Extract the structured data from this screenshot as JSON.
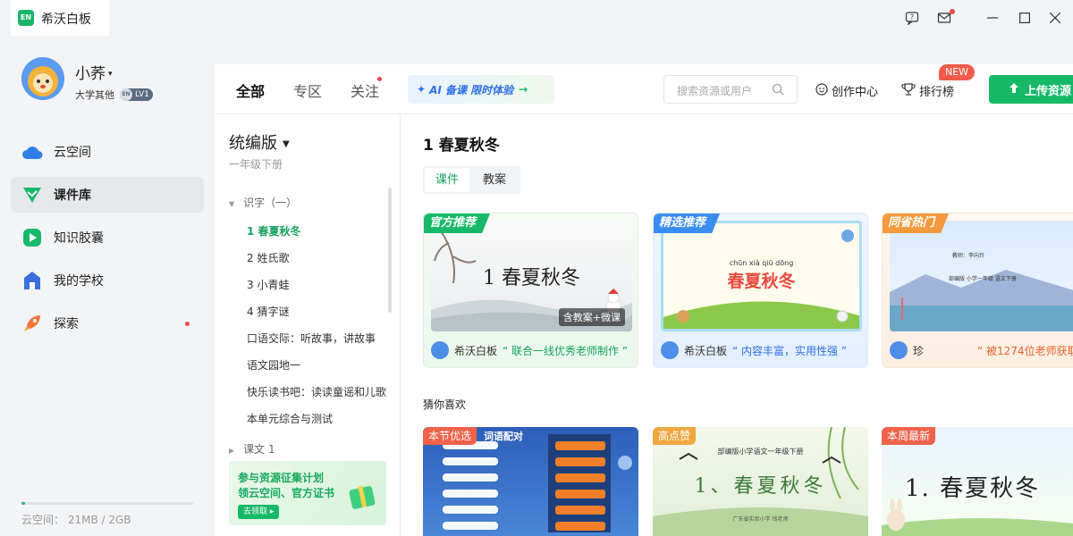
{
  "app": {
    "title": "希沃白板",
    "logo_text": "EN"
  },
  "user": {
    "name": "小荞",
    "role": "大学其他",
    "level": "LV1",
    "level_prefix": "EN"
  },
  "sidebar": {
    "items": [
      {
        "label": "云空间",
        "active": false
      },
      {
        "label": "课件库",
        "active": true
      },
      {
        "label": "知识胶囊",
        "active": false
      },
      {
        "label": "我的学校",
        "active": false
      },
      {
        "label": "探索",
        "active": false
      }
    ],
    "storage": {
      "text": "云空间：  21MB / 2GB",
      "used_fraction": 0.01
    }
  },
  "topnav": {
    "tabs": [
      {
        "label": "全部",
        "active": true
      },
      {
        "label": "专区",
        "active": false
      },
      {
        "label": "关注",
        "active": false
      }
    ],
    "ai_banner": "AI 备课 限时体验",
    "search_placeholder": "搜索资源或用户",
    "create_center": "创作中心",
    "ranking": "排行榜",
    "new_badge": "NEW",
    "upload": "上传资源"
  },
  "tree": {
    "edition": "统编版",
    "grade": "一年级下册",
    "unit1": "识字（一）",
    "lessons": [
      "1 春夏秋冬",
      "2 姓氏歌",
      "3 小青蛙",
      "4 猜字谜",
      "口语交际：听故事，讲故事",
      "语文园地一",
      "快乐读书吧：读读童谣和儿歌",
      "本单元综合与测试"
    ],
    "unit2": "课文 1",
    "promo": {
      "line1": "参与资源征集计划",
      "line2": "领云空间、官方证书",
      "button": "去领取 ▸"
    }
  },
  "content": {
    "title": "1 春夏秋冬",
    "segments": [
      {
        "label": "课件",
        "active": true
      },
      {
        "label": "教案",
        "active": false
      }
    ],
    "cards": [
      {
        "tag": "官方推荐",
        "image_title": "1 春夏秋冬",
        "image_badge": "含教案+微课",
        "author": "希沃白板",
        "quote": "联合一线优秀老师制作"
      },
      {
        "tag": "精选推荐",
        "pinyin": "chūn xià qiū dōng",
        "image_title": "春夏秋冬",
        "author": "希沃白板",
        "quote": "内容丰富，实用性强"
      },
      {
        "tag": "同省热门",
        "image_line1": "教师：李向玲",
        "image_line2": "部编版 小学一年级 语文下册",
        "author": "珍",
        "quote": "被1274位老师获取"
      }
    ],
    "guess_label": "猜你喜欢",
    "rec_cards": [
      {
        "tag": "本节优选",
        "header": "词语配对"
      },
      {
        "tag": "高点赞",
        "header": "部编版小学语文一年级下册",
        "image_title": "1、春夏秋冬",
        "footer": "广东省实验小学   钱老师"
      },
      {
        "tag": "本周最新",
        "image_title": "1. 春夏秋冬"
      }
    ]
  },
  "colors": {
    "brand": "#17b969",
    "accent_red": "#f04848",
    "blue": "#2f6fe6"
  }
}
